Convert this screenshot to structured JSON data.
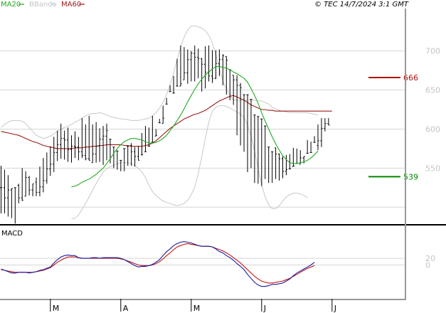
{
  "header": {
    "legend": [
      {
        "label": "MA20",
        "color": "#22aa22"
      },
      {
        "label": "BBands",
        "color": "#c8c8c8"
      },
      {
        "label": "MA60",
        "color": "#a01818"
      }
    ],
    "copyright": "© TEC 14/7/2024 3:1 GMT"
  },
  "chart_data": [
    {
      "type": "ohlc",
      "title": "",
      "y_ticks": [
        "550",
        "600",
        "650",
        "700"
      ],
      "ylim": [
        490,
        725
      ],
      "x_month_labels": [
        "M",
        "A",
        "M",
        "J",
        "J"
      ],
      "x_month_start_index": [
        14,
        34,
        54,
        74,
        94
      ],
      "n_sessions": 104,
      "close": [
        525,
        512,
        522,
        548,
        528,
        512,
        509,
        538,
        522,
        532,
        519,
        526,
        534,
        549,
        555,
        570,
        580,
        588,
        586,
        574,
        578,
        577,
        571,
        566,
        562,
        555,
        568,
        578,
        587,
        591,
        598,
        591,
        603,
        601,
        599,
        588,
        579,
        571,
        565,
        559,
        556,
        562,
        568,
        574,
        592,
        604,
        614,
        622,
        628,
        641,
        653,
        658,
        672,
        689,
        697,
        692,
        690,
        683,
        673,
        668,
        665,
        684,
        689,
        694,
        688,
        676,
        663,
        656,
        653,
        671,
        684,
        685,
        676,
        664,
        648,
        631,
        606,
        583,
        568,
        562,
        546,
        548,
        549,
        553,
        550,
        563,
        566,
        559,
        556,
        579,
        585,
        601,
        607,
        596,
        603
      ],
      "close_series_start_index": 0,
      "bar_high": [
        553,
        548,
        541,
        524,
        525,
        530,
        550,
        546,
        540,
        530,
        538,
        552,
        563,
        570,
        578,
        590,
        598,
        607,
        598,
        602,
        592,
        597,
        590,
        614,
        606,
        617,
        606,
        609,
        601,
        604,
        607,
        587,
        577,
        572,
        560,
        575,
        578,
        582,
        577,
        578,
        595,
        604,
        602,
        617,
        600,
        613,
        630,
        640,
        656,
        668,
        690,
        707,
        705,
        702,
        700,
        707,
        703,
        691,
        706,
        707,
        701,
        701,
        702,
        696,
        693,
        676,
        669,
        669,
        659,
        644,
        644,
        638,
        618,
        616,
        613,
        604,
        577,
        571,
        576,
        569,
        565,
        567,
        568,
        576,
        575,
        573,
        565,
        586,
        584,
        591,
        606,
        614,
        614,
        614
      ],
      "bar_low": [
        492,
        492,
        488,
        486,
        479,
        505,
        508,
        514,
        515,
        514,
        514,
        514,
        519,
        530,
        540,
        545,
        559,
        562,
        561,
        558,
        557,
        563,
        560,
        563,
        560,
        560,
        557,
        557,
        558,
        554,
        560,
        556,
        550,
        548,
        546,
        546,
        553,
        553,
        552,
        560,
        567,
        571,
        578,
        583,
        591,
        608,
        607,
        632,
        648,
        646,
        655,
        655,
        663,
        658,
        661,
        661,
        665,
        648,
        652,
        661,
        659,
        664,
        668,
        656,
        644,
        637,
        631,
        592,
        579,
        571,
        545,
        550,
        531,
        530,
        527,
        536,
        531,
        531,
        536,
        534,
        537,
        541,
        549,
        552,
        556,
        555,
        556,
        569,
        570,
        583,
        573,
        577,
        597,
        605
      ],
      "series": [
        {
          "name": "MA20",
          "color": "#22aa22",
          "values": [
            null,
            null,
            null,
            null,
            null,
            null,
            null,
            null,
            null,
            null,
            null,
            null,
            null,
            null,
            null,
            null,
            null,
            null,
            null,
            null,
            526,
            527,
            529,
            532,
            534,
            536,
            539,
            542,
            546,
            550,
            556,
            562,
            569,
            575,
            580,
            584,
            586,
            588,
            588,
            587,
            586,
            584,
            582,
            582,
            583,
            585,
            588,
            592,
            598,
            604,
            611,
            618,
            626,
            635,
            643,
            651,
            658,
            664,
            669,
            673,
            677,
            680,
            680,
            679,
            678,
            676,
            673,
            671,
            668,
            665,
            660,
            652,
            643,
            633,
            621,
            610,
            600,
            590,
            581,
            573,
            566,
            561,
            557,
            556,
            556,
            557,
            558,
            560,
            563,
            567,
            572
          ]
        },
        {
          "name": "MA60",
          "color": "#a01818",
          "values": [
            597,
            596,
            595,
            594,
            593,
            592,
            590,
            588,
            586,
            584,
            583,
            581,
            579,
            578,
            577,
            576,
            575,
            575,
            575,
            575,
            575,
            576,
            576,
            576,
            577,
            577,
            578,
            578,
            579,
            579,
            580,
            580,
            580,
            580,
            580,
            579,
            579,
            578,
            578,
            578,
            578,
            579,
            580,
            582,
            585,
            589,
            593,
            597,
            601,
            604,
            607,
            610,
            613,
            615,
            617,
            619,
            620,
            622,
            624,
            627,
            630,
            633,
            636,
            638,
            640,
            642,
            643,
            641,
            639,
            637,
            634,
            631,
            629,
            627,
            625,
            625,
            624,
            624,
            623,
            623,
            623,
            623,
            623,
            623,
            623,
            623,
            623,
            623,
            623,
            623,
            623,
            623,
            623,
            623,
            623
          ]
        },
        {
          "name": "BBands upper",
          "color": "#c8c8c8",
          "values": [
            602,
            606,
            609,
            611,
            611,
            611,
            610,
            607,
            602,
            597,
            592,
            590,
            588,
            589,
            591,
            594,
            597,
            600,
            602,
            604,
            606,
            609,
            611,
            614,
            617,
            619,
            620,
            620,
            621,
            620,
            618,
            616,
            615,
            614,
            613,
            613,
            612,
            611,
            611,
            611,
            612,
            613,
            614,
            617,
            621,
            627,
            634,
            644,
            657,
            672,
            689,
            705,
            718,
            727,
            732,
            732,
            731,
            729,
            726,
            720,
            710,
            695,
            678,
            661,
            651,
            643,
            637,
            637,
            637,
            637,
            637,
            637,
            637,
            636,
            636,
            634,
            632,
            628,
            626,
            624,
            623,
            622,
            621,
            621,
            621,
            621,
            621,
            621,
            620,
            619,
            618
          ]
        },
        {
          "name": "BBands lower",
          "color": "#c8c8c8",
          "values": [
            null,
            null,
            null,
            null,
            null,
            null,
            null,
            null,
            null,
            null,
            null,
            null,
            null,
            null,
            null,
            null,
            null,
            null,
            null,
            null,
            485,
            486,
            490,
            497,
            505,
            513,
            522,
            530,
            538,
            545,
            549,
            552,
            554,
            556,
            557,
            557,
            557,
            556,
            553,
            550,
            545,
            538,
            528,
            520,
            515,
            511,
            508,
            506,
            505,
            503,
            502,
            503,
            505,
            509,
            516,
            526,
            543,
            565,
            588,
            609,
            623,
            628,
            630,
            630,
            629,
            627,
            624,
            622,
            619,
            615,
            605,
            591,
            572,
            549,
            529,
            513,
            503,
            498,
            498,
            502,
            508,
            513,
            516,
            518,
            518,
            517,
            515,
            512
          ]
        },
        {
          "name": "MACD",
          "color": "#1a1aa0",
          "values": [
            -12,
            -16,
            -20,
            -24,
            -24,
            -22,
            -22,
            -22,
            -24,
            -22,
            -20,
            -16,
            -14,
            -10,
            -6,
            6,
            16,
            24,
            28,
            30,
            28,
            28,
            22,
            20,
            20,
            20,
            22,
            22,
            20,
            22,
            22,
            22,
            22,
            22,
            20,
            16,
            10,
            4,
            -2,
            -6,
            -4,
            -4,
            -2,
            2,
            8,
            16,
            28,
            40,
            48,
            58,
            64,
            68,
            70,
            68,
            66,
            62,
            58,
            56,
            56,
            56,
            54,
            48,
            40,
            36,
            28,
            22,
            14,
            4,
            -4,
            -14,
            -28,
            -40,
            -52,
            -60,
            -64,
            -64,
            -62,
            -58,
            -58,
            -56,
            -54,
            -48,
            -42,
            -32,
            -24,
            -18,
            -12,
            -6,
            0,
            8
          ]
        },
        {
          "name": "Signal",
          "color": "#c01818",
          "values": [
            -14,
            -16,
            -18,
            -20,
            -22,
            -22,
            -22,
            -22,
            -22,
            -22,
            -20,
            -18,
            -16,
            -12,
            -8,
            0,
            8,
            14,
            20,
            24,
            24,
            24,
            22,
            20,
            20,
            20,
            20,
            20,
            20,
            20,
            20,
            20,
            20,
            20,
            18,
            16,
            12,
            8,
            4,
            0,
            -2,
            -2,
            -2,
            0,
            4,
            10,
            18,
            28,
            36,
            46,
            54,
            58,
            62,
            64,
            62,
            60,
            58,
            56,
            56,
            56,
            54,
            50,
            46,
            42,
            36,
            30,
            22,
            14,
            6,
            -4,
            -14,
            -24,
            -34,
            -42,
            -48,
            -52,
            -54,
            -54,
            -52,
            -50,
            -48,
            -44,
            -40,
            -34,
            -28,
            -22,
            -16,
            -10,
            -6,
            -2
          ]
        }
      ],
      "levels": [
        {
          "label": "666",
          "value": 666,
          "color": "#b01010"
        },
        {
          "label": "539",
          "value": 539,
          "color": "#008800"
        }
      ]
    },
    {
      "type": "line",
      "title": "MACD",
      "y_ticks": [
        "0",
        "20"
      ],
      "ylim": [
        -90,
        90
      ],
      "series_names": [
        "MACD",
        "Signal"
      ]
    }
  ]
}
